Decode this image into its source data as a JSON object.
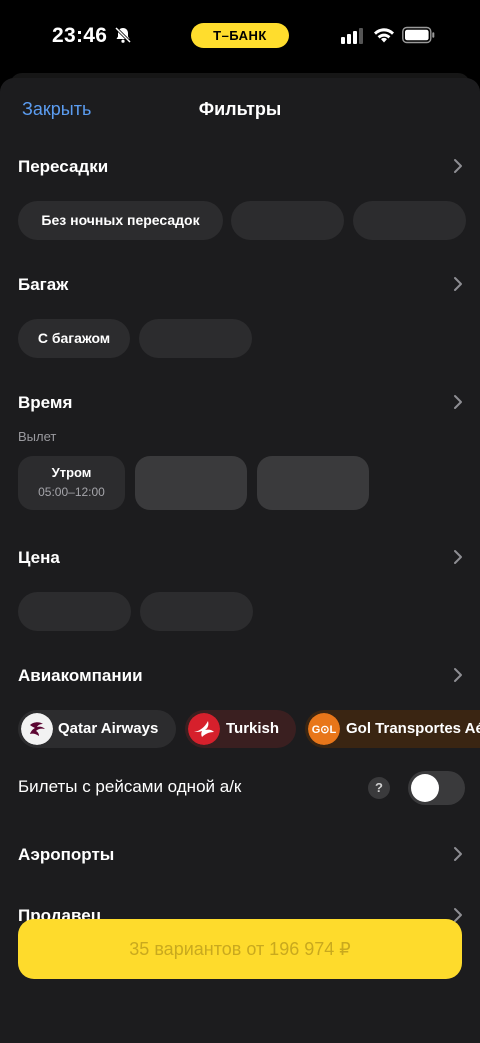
{
  "status": {
    "time": "23:46",
    "bank": "Т–БАНК"
  },
  "header": {
    "close": "Закрыть",
    "title": "Фильтры"
  },
  "sections": {
    "transfers": {
      "title": "Пересадки",
      "chip": "Без ночных пересадок"
    },
    "baggage": {
      "title": "Багаж",
      "chip": "С багажом"
    },
    "time": {
      "title": "Время",
      "sub": "Вылет",
      "chip_label": "Утром",
      "chip_range": "05:00–12:00"
    },
    "price": {
      "title": "Цена"
    },
    "airlines": {
      "title": "Авиакомпании",
      "items": [
        {
          "name": "Qatar Airways"
        },
        {
          "name": "Turkish"
        },
        {
          "name": "Gol Transportes Aé"
        }
      ],
      "toggle_label": "Билеты с рейсами одной а/к",
      "help": "?",
      "toggle_on": false
    },
    "airports": {
      "title": "Аэропорты"
    },
    "seller": {
      "title": "Продавец"
    }
  },
  "cta": {
    "label": "35 вариантов от 196 974 ₽"
  },
  "colors": {
    "accent": "#fedb2c",
    "link": "#5b9cf0",
    "sheet": "#1c1c1e",
    "chip": "#2c2c2e"
  }
}
